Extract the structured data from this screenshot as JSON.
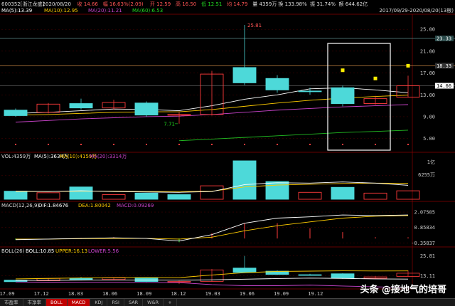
{
  "header": {
    "code": "600352",
    "name": "浙江龙盛",
    "date": "2020/08/20",
    "close": "收 14.66",
    "change": "幅 16.63%(2.09)",
    "open": "开 12.59",
    "high": "高 16.50",
    "low": "低 12.51",
    "low2": "均 14.79",
    "volume": "量 4359万",
    "turnover": "换 133.98%",
    "amplitude": "振 31.74%",
    "amount": "额 644.62亿",
    "range": "2017/09/29-2020/08/20(13根)"
  },
  "ma_legend": {
    "ma5": "MA(5):13.39",
    "ma10": "MA(10):12.95",
    "ma20": "MA(20):11.21",
    "ma60": "MA(60):6.53"
  },
  "price_axis": [
    "25.00",
    "21.00",
    "17.00",
    "13.00",
    "9.00",
    "5.00"
  ],
  "price_badges": {
    "high_line": "23.33",
    "mid_line": "18.33",
    "current": "14.66"
  },
  "annotations": {
    "peak": "25.81",
    "trough": "7.71"
  },
  "vol_legend": {
    "vol": "VOL:4359万",
    "ma5": "MA(5):3634万",
    "ma10": "MA(10):4159万",
    "ma20": "MA(20):3314万"
  },
  "vol_axis": {
    "top": "1亿",
    "mid": "6255万"
  },
  "macd_legend": {
    "title": "MACD(12,26,9)",
    "dif": "DIF:1.84676",
    "dea": "DEA:1.80042",
    "macd": "MACD:0.09269"
  },
  "macd_axis": [
    "2.07505",
    "0.85834",
    "-0.35837"
  ],
  "boll_legend": {
    "title": "BOLL(26)",
    "boll": "BOLL:10.85",
    "upper": "UPPER:16.13",
    "lower": "LOWER:5.56"
  },
  "boll_axis": [
    "25.81",
    "13.11"
  ],
  "x_axis": [
    "17.09",
    "17.12",
    "18.03",
    "18.06",
    "18.09",
    "18.12",
    "19.03",
    "19.06",
    "19.09",
    "19.12"
  ],
  "tabs": [
    "市盈率",
    "市净率",
    "BOLL",
    "MACD",
    "KDJ",
    "RSI",
    "SAR",
    "W&R",
    "+"
  ],
  "watermark": "头条 @接地气的培哥",
  "colors": {
    "up": "#ff3b3b",
    "down": "#4dd9d9",
    "ma5": "#ffffff",
    "ma10": "#ffcc00",
    "ma20": "#cc44cc",
    "ma60": "#22bb22"
  },
  "chart_data": {
    "type": "candlestick",
    "period": "quarterly",
    "candles": [
      {
        "x": "17.09",
        "open": 10.2,
        "close": 9.2,
        "high": 10.5,
        "low": 9.0
      },
      {
        "x": "17.12",
        "open": 9.8,
        "close": 11.3,
        "high": 11.5,
        "low": 9.6
      },
      {
        "x": "18.03",
        "open": 11.4,
        "close": 10.6,
        "high": 12.3,
        "low": 10.3
      },
      {
        "x": "18.06",
        "open": 10.6,
        "close": 11.6,
        "high": 12.1,
        "low": 10.3
      },
      {
        "x": "18.09",
        "open": 11.5,
        "close": 9.3,
        "high": 11.8,
        "low": 9.0
      },
      {
        "x": "18.12",
        "open": 9.3,
        "close": 9.4,
        "high": 9.8,
        "low": 7.71
      },
      {
        "x": "19.03",
        "open": 9.4,
        "close": 16.8,
        "high": 17.4,
        "low": 9.2
      },
      {
        "x": "19.06",
        "open": 18.0,
        "close": 15.2,
        "high": 25.81,
        "low": 14.8
      },
      {
        "x": "19.09",
        "open": 16.0,
        "close": 13.9,
        "high": 16.6,
        "low": 13.4
      },
      {
        "x": "19.12",
        "open": 13.7,
        "close": 13.6,
        "high": 14.3,
        "low": 13.0
      },
      {
        "x": "20.03",
        "open": 14.3,
        "close": 11.4,
        "high": 14.7,
        "low": 10.9
      },
      {
        "x": "20.06",
        "open": 11.4,
        "close": 12.3,
        "high": 12.8,
        "low": 11.2
      },
      {
        "x": "20.08",
        "open": 12.59,
        "close": 14.66,
        "high": 16.5,
        "low": 12.51
      }
    ],
    "ma5": [
      9.6,
      9.8,
      10.1,
      10.4,
      10.3,
      10.1,
      11.0,
      12.2,
      13.0,
      14.1,
      14.3,
      13.9,
      13.39
    ],
    "ma10": [
      9.3,
      9.4,
      9.6,
      9.8,
      9.9,
      9.9,
      10.3,
      10.9,
      11.5,
      12.0,
      12.4,
      12.7,
      12.95
    ],
    "ma20": [
      8.0,
      8.3,
      8.6,
      8.8,
      9.0,
      9.1,
      9.4,
      9.8,
      10.2,
      10.5,
      10.8,
      11.0,
      11.21
    ],
    "ma60": [
      null,
      null,
      null,
      null,
      null,
      4.6,
      4.9,
      5.2,
      5.5,
      5.8,
      6.1,
      6.3,
      6.53
    ],
    "markers": [
      {
        "x": "20.03",
        "y": 17.5
      },
      {
        "x": "20.06",
        "y": 16.0
      },
      {
        "x": "20.08",
        "y": 18.33
      }
    ],
    "highlight_range": [
      "20.03",
      "20.06"
    ],
    "volume": [
      {
        "x": "17.09",
        "v": 2100,
        "up": false
      },
      {
        "x": "17.12",
        "v": 1700,
        "up": true
      },
      {
        "x": "18.03",
        "v": 3200,
        "up": false
      },
      {
        "x": "18.06",
        "v": 1200,
        "up": true
      },
      {
        "x": "18.09",
        "v": 1600,
        "up": false
      },
      {
        "x": "18.12",
        "v": 1200,
        "up": false
      },
      {
        "x": "19.03",
        "v": 3500,
        "up": true
      },
      {
        "x": "19.06",
        "v": 10000,
        "up": false
      },
      {
        "x": "19.09",
        "v": 4600,
        "up": false
      },
      {
        "x": "19.12",
        "v": 1800,
        "up": true
      },
      {
        "x": "20.03",
        "v": 3100,
        "up": false
      },
      {
        "x": "20.06",
        "v": 1600,
        "up": true
      },
      {
        "x": "20.08",
        "v": 2200,
        "up": true
      }
    ],
    "vol_ma5": [
      2100,
      2000,
      2200,
      2000,
      1900,
      1800,
      2000,
      3800,
      4300,
      4200,
      4500,
      4200,
      3634
    ],
    "vol_ma10": [
      2000,
      2000,
      2100,
      2100,
      2000,
      2000,
      2100,
      3200,
      3700,
      3900,
      4100,
      4200,
      4159
    ],
    "macd_dif": [
      -0.1,
      -0.05,
      0.0,
      0.05,
      0.0,
      -0.2,
      0.3,
      1.2,
      1.6,
      1.7,
      1.85,
      1.8,
      1.84676
    ],
    "macd_dea": [
      -0.05,
      -0.05,
      -0.02,
      0.0,
      0.0,
      -0.05,
      0.1,
      0.6,
      1.0,
      1.3,
      1.6,
      1.75,
      1.80042
    ],
    "boll_mid": [
      10.0,
      10.1,
      10.2,
      10.3,
      10.3,
      10.2,
      10.4,
      10.8,
      11.2,
      11.5,
      11.3,
      11.0,
      10.85
    ],
    "boll_upper": [
      11.0,
      11.3,
      11.6,
      11.8,
      11.9,
      11.8,
      13.5,
      15.0,
      15.8,
      16.0,
      16.2,
      16.1,
      16.13
    ],
    "boll_lower": [
      9.0,
      8.9,
      8.8,
      8.8,
      8.7,
      8.6,
      7.3,
      6.6,
      6.6,
      7.0,
      6.4,
      5.9,
      5.56
    ]
  }
}
